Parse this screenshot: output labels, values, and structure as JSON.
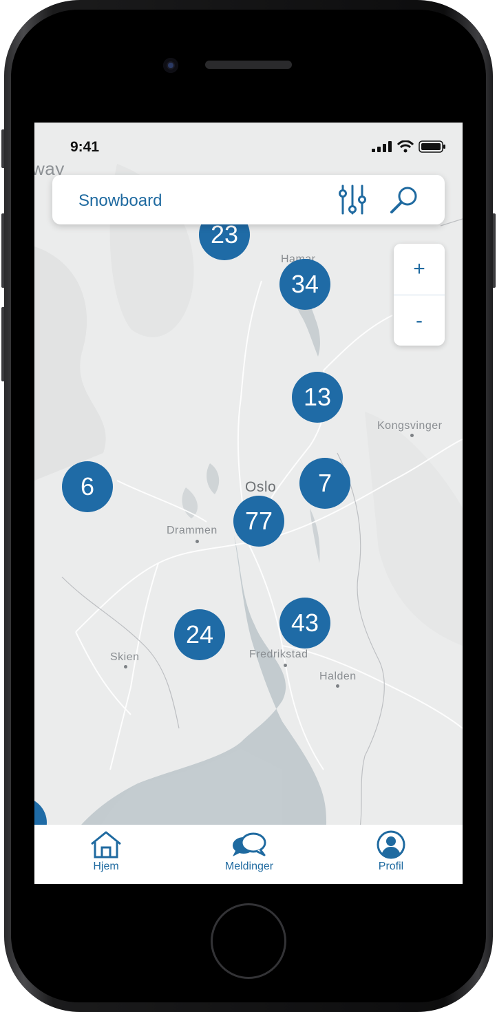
{
  "status": {
    "time": "9:41"
  },
  "search": {
    "query": "Snowboard"
  },
  "zoom": {
    "in_label": "+",
    "out_label": "-"
  },
  "map": {
    "corner_text": "way",
    "places": [
      {
        "name": "Hamar",
        "id": "hamar"
      },
      {
        "name": "Kongsvinger",
        "id": "kongsvinger"
      },
      {
        "name": "Oslo",
        "id": "oslo"
      },
      {
        "name": "Drammen",
        "id": "drammen"
      },
      {
        "name": "Skien",
        "id": "skien"
      },
      {
        "name": "Fredrikstad",
        "id": "fredrikstad"
      },
      {
        "name": "Halden",
        "id": "halden"
      }
    ],
    "clusters": [
      {
        "count": "23"
      },
      {
        "count": "34"
      },
      {
        "count": "13"
      },
      {
        "count": "6"
      },
      {
        "count": "7"
      },
      {
        "count": "77"
      },
      {
        "count": "24"
      },
      {
        "count": "43"
      }
    ],
    "accent": "#1f6ba6"
  },
  "tabs": [
    {
      "label": "Hjem",
      "icon": "home-icon"
    },
    {
      "label": "Meldinger",
      "icon": "chat-icon"
    },
    {
      "label": "Profil",
      "icon": "profile-icon"
    }
  ]
}
